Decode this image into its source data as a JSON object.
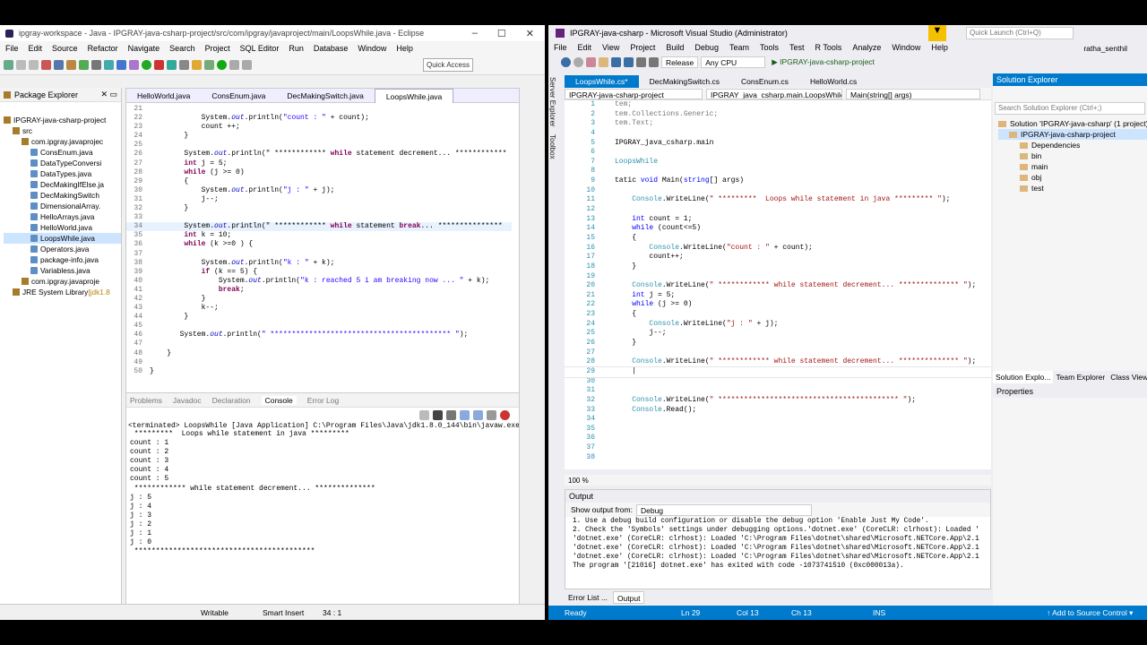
{
  "eclipse": {
    "title": "ipgray-workspace - Java - IPGRAY-java-csharp-project/src/com/ipgray/javaproject/main/LoopsWhile.java - Eclipse",
    "window_controls": [
      "–",
      "☐",
      "✕"
    ],
    "menu": [
      "File",
      "Edit",
      "Source",
      "Refactor",
      "Navigate",
      "Search",
      "Project",
      "SQL Editor",
      "Run",
      "Database",
      "Window",
      "Help"
    ],
    "quick_access": "Quick Access",
    "package_explorer": {
      "title": "Package Explorer",
      "items": [
        {
          "label": "IPGRAY-java-csharp-project",
          "indent": 0,
          "kind": "project"
        },
        {
          "label": "src",
          "indent": 1,
          "kind": "pkg"
        },
        {
          "label": "com.ipgray.javaprojec",
          "indent": 2,
          "kind": "pkg"
        },
        {
          "label": "ConsEnum.java",
          "indent": 3,
          "kind": "java"
        },
        {
          "label": "DataTypeConversi",
          "indent": 3,
          "kind": "java"
        },
        {
          "label": "DataTypes.java",
          "indent": 3,
          "kind": "java"
        },
        {
          "label": "DecMakingIfElse.ja",
          "indent": 3,
          "kind": "java"
        },
        {
          "label": "DecMakingSwitch",
          "indent": 3,
          "kind": "java"
        },
        {
          "label": "DimensionalArray.",
          "indent": 3,
          "kind": "java"
        },
        {
          "label": "HelloArrays.java",
          "indent": 3,
          "kind": "java"
        },
        {
          "label": "HelloWorld.java",
          "indent": 3,
          "kind": "java"
        },
        {
          "label": "LoopsWhile.java",
          "indent": 3,
          "kind": "java",
          "selected": true
        },
        {
          "label": "Operators.java",
          "indent": 3,
          "kind": "java"
        },
        {
          "label": "package-info.java",
          "indent": 3,
          "kind": "java"
        },
        {
          "label": "Variabless.java",
          "indent": 3,
          "kind": "java"
        },
        {
          "label": "com.ipgray.javaproje",
          "indent": 2,
          "kind": "pkg"
        },
        {
          "label": "JRE System Library",
          "indent": 1,
          "kind": "pkg",
          "suffix": "[jdk1.8"
        }
      ]
    },
    "editor_tabs": [
      "HelloWorld.java",
      "ConsEnum.java",
      "DecMakingSwitch.java",
      "LoopsWhile.java"
    ],
    "active_tab": "LoopsWhile.java",
    "code": [
      {
        "n": "21",
        "t": ""
      },
      {
        "n": "22",
        "t": "            System.out.println(\"count : \" + count);"
      },
      {
        "n": "23",
        "t": "            count ++;"
      },
      {
        "n": "24",
        "t": "        }"
      },
      {
        "n": "25",
        "t": ""
      },
      {
        "n": "26",
        "t": "        System.out.println(\" ************ while statement decrement... ************"
      },
      {
        "n": "27",
        "t": "        int j = 5;"
      },
      {
        "n": "28",
        "t": "        while (j >= 0)"
      },
      {
        "n": "29",
        "t": "        {"
      },
      {
        "n": "30",
        "t": "            System.out.println(\"j : \" + j);"
      },
      {
        "n": "31",
        "t": "            j--;"
      },
      {
        "n": "32",
        "t": "        }"
      },
      {
        "n": "33",
        "t": ""
      },
      {
        "n": "34",
        "t": "        System.out.println(\" ************ while statement break... ***************"
      },
      {
        "n": "35",
        "t": "        int k = 10;"
      },
      {
        "n": "36",
        "t": "        while (k >=0 ) {"
      },
      {
        "n": "37",
        "t": ""
      },
      {
        "n": "38",
        "t": "            System.out.println(\"k : \" + k);"
      },
      {
        "n": "39",
        "t": "            if (k == 5) {"
      },
      {
        "n": "40",
        "t": "                System.out.println(\"k : reached 5 i am breaking now ... \" + k);"
      },
      {
        "n": "41",
        "t": "                break;"
      },
      {
        "n": "42",
        "t": "            }"
      },
      {
        "n": "43",
        "t": "            k--;"
      },
      {
        "n": "44",
        "t": "        }"
      },
      {
        "n": "45",
        "t": ""
      },
      {
        "n": "46",
        "t": "       System.out.println(\" ****************************************** \");"
      },
      {
        "n": "47",
        "t": ""
      },
      {
        "n": "48",
        "t": "    }"
      },
      {
        "n": "49",
        "t": ""
      },
      {
        "n": "50",
        "t": "}"
      }
    ],
    "console_tabs": [
      "Problems",
      "Javadoc",
      "Declaration",
      "Console",
      "Error Log"
    ],
    "console_active": "Console",
    "console_terminated": "<terminated> LoopsWhile [Java Application] C:\\Program Files\\Java\\jdk1.8.0_144\\bin\\javaw.exe (Mar 10, 2020, 12:05:40 AM)",
    "console_output": [
      " *********  Loops while statement in java *********",
      "count : 1",
      "count : 2",
      "count : 3",
      "count : 4",
      "count : 5",
      " ************ while statement decrement... **************",
      "j : 5",
      "j : 4",
      "j : 3",
      "j : 2",
      "j : 1",
      "j : 0",
      " ******************************************"
    ],
    "status": {
      "writable": "Writable",
      "insert": "Smart Insert",
      "position": "34 : 1"
    }
  },
  "vs": {
    "title": "IPGRAY-java-csharp - Microsoft Visual Studio  (Administrator)",
    "quick_launch": "Quick Launch (Ctrl+Q)",
    "user": "ratha_senthil",
    "menu": [
      "File",
      "Edit",
      "View",
      "Project",
      "Build",
      "Debug",
      "Team",
      "Tools",
      "Test",
      "R Tools",
      "Analyze",
      "Window",
      "Help"
    ],
    "config": "Release",
    "platform": "Any CPU",
    "start_project": "▶ IPGRAY-java-csharp-project",
    "side_tabs": [
      "Server Explorer",
      "Toolbox"
    ],
    "tabs": [
      "LoopsWhile.cs*",
      "DecMakingSwitch.cs",
      "ConsEnum.cs",
      "HelloWorld.cs"
    ],
    "nav": [
      "IPGRAY-java-csharp-project",
      "IPGRAY_java_csharp.main.LoopsWhile",
      "Main(string[] args)"
    ],
    "code": [
      {
        "n": "1",
        "t": "tem;"
      },
      {
        "n": "2",
        "t": "tem.Collections.Generic;"
      },
      {
        "n": "3",
        "t": "tem.Text;"
      },
      {
        "n": "4",
        "t": ""
      },
      {
        "n": "5",
        "t": "IPGRAY_java_csharp.main"
      },
      {
        "n": "6",
        "t": ""
      },
      {
        "n": "7",
        "t": "LoopsWhile"
      },
      {
        "n": "8",
        "t": ""
      },
      {
        "n": "9",
        "t": "tatic void Main(string[] args)"
      },
      {
        "n": "10",
        "t": ""
      },
      {
        "n": "11",
        "t": "    Console.WriteLine(\" *********  Loops while statement in java ********* \");"
      },
      {
        "n": "12",
        "t": ""
      },
      {
        "n": "13",
        "t": "    int count = 1;"
      },
      {
        "n": "14",
        "t": "    while (count<=5)"
      },
      {
        "n": "15",
        "t": "    {"
      },
      {
        "n": "16",
        "t": "        Console.WriteLine(\"count : \" + count);"
      },
      {
        "n": "17",
        "t": "        count++;"
      },
      {
        "n": "18",
        "t": "    }"
      },
      {
        "n": "19",
        "t": ""
      },
      {
        "n": "20",
        "t": "    Console.WriteLine(\" ************ while statement decrement... ************** \");"
      },
      {
        "n": "21",
        "t": "    int j = 5;"
      },
      {
        "n": "22",
        "t": "    while (j >= 0)"
      },
      {
        "n": "23",
        "t": "    {"
      },
      {
        "n": "24",
        "t": "        Console.WriteLine(\"j : \" + j);"
      },
      {
        "n": "25",
        "t": "        j--;"
      },
      {
        "n": "26",
        "t": "    }"
      },
      {
        "n": "27",
        "t": ""
      },
      {
        "n": "28",
        "t": "    Console.WriteLine(\" ************ while statement decrement... ************** \");"
      },
      {
        "n": "29",
        "t": "    |"
      },
      {
        "n": "30",
        "t": ""
      },
      {
        "n": "31",
        "t": ""
      },
      {
        "n": "32",
        "t": "    Console.WriteLine(\" ****************************************** \");"
      },
      {
        "n": "33",
        "t": "    Console.Read();"
      },
      {
        "n": "34",
        "t": ""
      },
      {
        "n": "35",
        "t": ""
      },
      {
        "n": "36",
        "t": ""
      },
      {
        "n": "37",
        "t": ""
      },
      {
        "n": "38",
        "t": ""
      }
    ],
    "zoom": "100 %",
    "output_title": "Output",
    "output_from_label": "Show output from:",
    "output_from": "Debug",
    "output_lines": [
      "1. Use a debug build configuration or disable the debug option 'Enable Just My Code'.",
      "2. Check the 'Symbols' settings under debugging options.'dotnet.exe' (CoreCLR: clrhost): Loaded '",
      "'dotnet.exe' (CoreCLR: clrhost): Loaded 'C:\\Program Files\\dotnet\\shared\\Microsoft.NETCore.App\\2.1",
      "'dotnet.exe' (CoreCLR: clrhost): Loaded 'C:\\Program Files\\dotnet\\shared\\Microsoft.NETCore.App\\2.1",
      "'dotnet.exe' (CoreCLR: clrhost): Loaded 'C:\\Program Files\\dotnet\\shared\\Microsoft.NETCore.App\\2.1",
      "The program '[21016] dotnet.exe' has exited with code -1073741510 (0xc000013a)."
    ],
    "bottom_tabs": [
      "Error List ...",
      "Output"
    ],
    "solution_explorer": {
      "title": "Solution Explorer",
      "search": "Search Solution Explorer (Ctrl+;)",
      "items": [
        {
          "label": "Solution 'IPGRAY-java-csharp' (1 project)",
          "indent": 0
        },
        {
          "label": "IPGRAY-java-csharp-project",
          "indent": 1,
          "selected": true
        },
        {
          "label": "Dependencies",
          "indent": 2
        },
        {
          "label": "bin",
          "indent": 2
        },
        {
          "label": "main",
          "indent": 2
        },
        {
          "label": "obj",
          "indent": 2
        },
        {
          "label": "test",
          "indent": 2
        }
      ]
    },
    "panel_tabs": [
      "Solution Explo...",
      "Team Explorer",
      "Class View"
    ],
    "properties_title": "Properties",
    "status": {
      "ready": "Ready",
      "ln": "Ln 29",
      "col": "Col 13",
      "ch": "Ch 13",
      "ins": "INS",
      "source": "↑ Add to Source Control ▾"
    }
  }
}
